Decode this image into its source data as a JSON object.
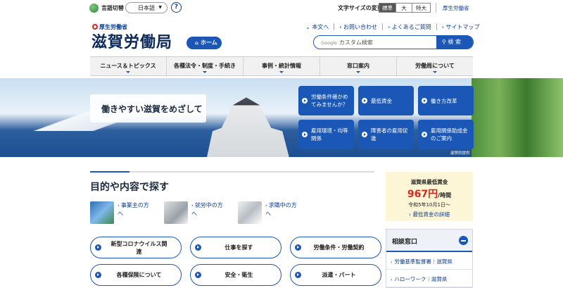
{
  "topbar": {
    "lang_label": "言語切替",
    "lang_value": "日本語",
    "help": "?",
    "font_size_label": "文字サイズの変更",
    "font_sizes": [
      "標準",
      "大",
      "特大"
    ],
    "mhlw_link": "厚生労働省"
  },
  "header": {
    "ministry": "厚生労働省",
    "site_title": "滋賀労働局",
    "home": "ホーム",
    "util_links": [
      "本文へ",
      "お問い合わせ",
      "よくあるご質問",
      "サイトマップ"
    ],
    "search_brand": "Google",
    "search_placeholder": "カスタム検索",
    "search_button": "検 索"
  },
  "gnav": [
    "ニュース＆トピックス",
    "各種法令・制度・手続き",
    "事例・統計情報",
    "窓口案内",
    "労働局について"
  ],
  "hero": {
    "slogan": "働きやすい滋賀をめざして",
    "tiles": [
      "労働条件確かめてみませんか？",
      "最低賃金",
      "働き方改革",
      "雇用環境・均等関係",
      "障害者の雇用促進",
      "雇用関係助成金のご案内"
    ],
    "credit": "滋賀県提供"
  },
  "purpose": {
    "title": "目的や内容で探す",
    "audiences": [
      "事業主の方へ",
      "就労中の方へ",
      "求職中の方へ"
    ],
    "pills": [
      "新型コロナウイルス関連",
      "仕事を探す",
      "労働条件・労働契約",
      "各種保険について",
      "安全・衛生",
      "派遣・パート"
    ]
  },
  "wage": {
    "title": "滋賀県最低賃金",
    "amount": "967円",
    "unit": "/時間",
    "date": "令和5年10月1日～",
    "link": "最低賃金の詳細"
  },
  "consult": {
    "title": "相談窓口",
    "items": [
      "労働基準監督署｜滋賀県",
      "ハローワーク｜滋賀県"
    ]
  },
  "colors": {
    "primary": "#1a57b6",
    "wage_bg": "#fdf6d6",
    "wage_red": "#d4281c"
  }
}
